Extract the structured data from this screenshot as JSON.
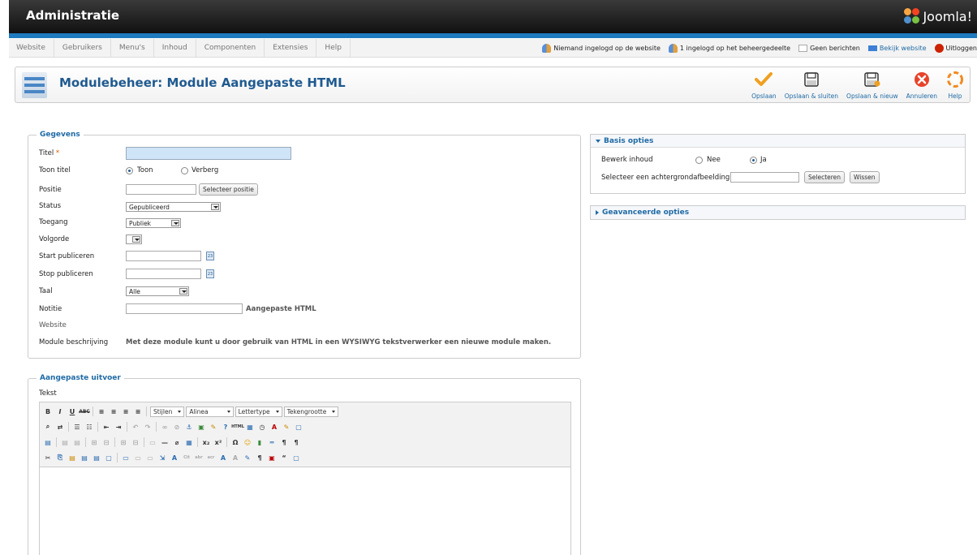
{
  "header": {
    "title": "Administratie",
    "logo_text": "Joomla!"
  },
  "menu": [
    {
      "label": "Website"
    },
    {
      "label": "Gebruikers"
    },
    {
      "label": "Menu's"
    },
    {
      "label": "Inhoud"
    },
    {
      "label": "Componenten"
    },
    {
      "label": "Extensies"
    },
    {
      "label": "Help"
    }
  ],
  "status": {
    "visitors": "Niemand ingelogd op de website",
    "admins": "1 ingelogd op het beheergedeelte",
    "messages": "Geen berichten",
    "view_site": "Bekijk website",
    "logout": "Uitloggen"
  },
  "toolbar": {
    "title": "Modulebeheer: Module Aangepaste HTML",
    "buttons": [
      {
        "label": "Opslaan",
        "icon": "check-icon"
      },
      {
        "label": "Opslaan & sluiten",
        "icon": "save-close-icon"
      },
      {
        "label": "Opslaan & nieuw",
        "icon": "save-new-icon"
      },
      {
        "label": "Annuleren",
        "icon": "cancel-icon"
      },
      {
        "label": "Help",
        "icon": "help-icon"
      }
    ]
  },
  "details": {
    "legend": "Gegevens",
    "title_label": "Titel",
    "title_required_mark": "*",
    "title_value": "",
    "show_title_label": "Toon titel",
    "show_title_options": [
      "Toon",
      "Verberg"
    ],
    "show_title_selected": "Toon",
    "position_label": "Positie",
    "position_value": "",
    "position_button": "Selecteer positie",
    "status_label": "Status",
    "status_value": "Gepubliceerd",
    "access_label": "Toegang",
    "access_value": "Publiek",
    "ordering_label": "Volgorde",
    "ordering_value": "",
    "start_label": "Start publiceren",
    "start_value": "",
    "stop_label": "Stop publiceren",
    "stop_value": "",
    "calendar_glyph": "23",
    "language_label": "Taal",
    "language_value": "Alle",
    "note_label": "Notitie",
    "note_value": "",
    "module_type": "Aangepaste HTML",
    "site_label": "Website",
    "description_label": "Module beschrijving",
    "description_text": "Met deze module kunt u door gebruik van HTML in een WYSIWYG tekstverwerker een nieuwe module maken."
  },
  "custom_output": {
    "legend": "Aangepaste uitvoer",
    "text_label": "Tekst",
    "editor_selects": [
      "Stijlen",
      "Alinea",
      "Lettertype",
      "Tekengrootte"
    ]
  },
  "basic_options": {
    "title": "Basis opties",
    "prepare_label": "Bewerk inhoud",
    "prepare_options": [
      "Nee",
      "Ja"
    ],
    "prepare_selected": "Ja",
    "background_label": "Selecteer een achtergrondafbeelding",
    "background_value": "",
    "select_button": "Selecteren",
    "clear_button": "Wissen"
  },
  "advanced_options": {
    "title": "Geavanceerde opties"
  }
}
